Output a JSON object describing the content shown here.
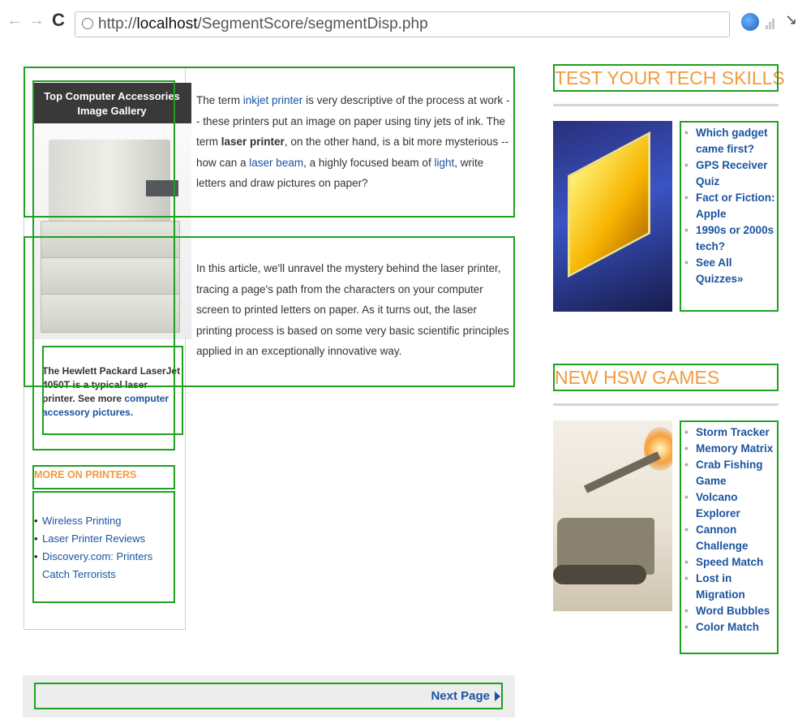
{
  "browser": {
    "url_prefix": "http://",
    "url_host": "localhost",
    "url_path": "/SegmentScore/segmentDisp.php"
  },
  "gallery": {
    "title": "Top Computer Accessories Image Gallery",
    "caption_text": "The Hewlett Packard LaserJet 4050T is a typical laser printer. See more ",
    "caption_link": "computer accessory pictures."
  },
  "article": {
    "p1": {
      "t1": "The term ",
      "link1": "inkjet printer",
      "t2": " is very descriptive of the process at work -- these printers put an image on paper using tiny jets of ink. The term ",
      "bold": "laser printer",
      "t3": ", on the other hand, is a bit more mysterious -- how can a ",
      "link2": "laser beam",
      "t4": ", a highly focused beam of ",
      "link3": "light",
      "t5": ", write letters and draw pictures on paper?"
    },
    "p2": "In this article, we'll unravel the mystery behind the laser printer, tracing a page's path from the characters on your computer screen to printed letters on paper. As it turns out, the laser printing process is based on some very basic scientific principles applied in an exceptionally innovative way."
  },
  "more_on": {
    "title": "MORE ON PRINTERS",
    "items": [
      "Wireless Printing",
      "Laser Printer Reviews",
      "Discovery.com: Printers Catch Terrorists"
    ]
  },
  "tech_skills": {
    "title": "TEST YOUR TECH SKILLS",
    "items": [
      "Which gadget came first?",
      "GPS Receiver Quiz",
      "Fact or Fiction: Apple",
      "1990s or 2000s tech?",
      "See All Quizzes»"
    ]
  },
  "games": {
    "title": "NEW HSW GAMES",
    "items": [
      "Storm Tracker",
      "Memory Matrix",
      "Crab Fishing Game",
      "Volcano Explorer",
      "Cannon Challenge",
      "Speed Match",
      "Lost in Migration",
      "Word Bubbles",
      "Color Match"
    ]
  },
  "pager": {
    "next_label": "Next Page"
  }
}
